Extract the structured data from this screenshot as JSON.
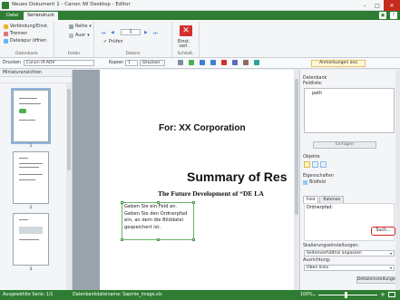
{
  "window": {
    "title": "Neues Dokument 1 - Canon iW Desktop - Editor"
  },
  "ribbon_tabs": {
    "datei": "Datei",
    "seriendruck": "Seriendruck"
  },
  "ribbon": {
    "datenbank": {
      "connect": "Verbindung/Einst.",
      "disconnect": "Trennen",
      "open_file": "Dateispur öffnen",
      "label": "Datenbank"
    },
    "felder": {
      "reihe": "Reihe",
      "auor": "Auor",
      "label": "Felder"
    },
    "datens": {
      "page": "1",
      "pruefen": "Prüfen",
      "label": "Datens"
    },
    "schliessen": {
      "button": "Einst.\nverl.",
      "label": "Schließ."
    }
  },
  "toolbar2": {
    "drucken_label": "Drucken",
    "printer": "Canon iR-ADV",
    "kopien_label": "Kopien",
    "kopien_value": "1",
    "print_button": "Drucken",
    "annotations_button": "Anmerkungen anz."
  },
  "left_panel": {
    "title": "Miniaturansichten",
    "thumbs": [
      "1",
      "2",
      "3"
    ]
  },
  "document": {
    "for_text": "For: XX Corporation",
    "summary_text": "Summary of Res",
    "future_text": "The Future Development of “DE LA",
    "field_text": "Geben Sie ein Feld an. Geben Sie den Ordnerpfad ein, an dem die Bilddatei gespeichert ist."
  },
  "right_panel": {
    "datenbank": "Datenbank",
    "feldliste": "Feldliste:",
    "field_item": "path",
    "einfuegen": "Einfügen",
    "objekte": "Objekte",
    "eigenschaften": "Eigenschaften",
    "bildfeld": "Bildfeld",
    "tab_feld": "Feld",
    "tab_rahmen": "Rahmen",
    "ordnerpfad": "Ordnerpfad:",
    "suchen": "Such...",
    "skalierung_label": "Skalierungseinstellungen:",
    "skalierung_value": "Seitenverhältnis anpassen",
    "ausrichtung_label": "Ausrichtung:",
    "ausrichtung_value": "Oben links",
    "details": "Detaileinstellungen..."
  },
  "status": {
    "left": "Ausgewählte Serie: 1/1",
    "db": "Datenbankdateiname: Sapmle_image.xls",
    "zoom": "100%"
  }
}
